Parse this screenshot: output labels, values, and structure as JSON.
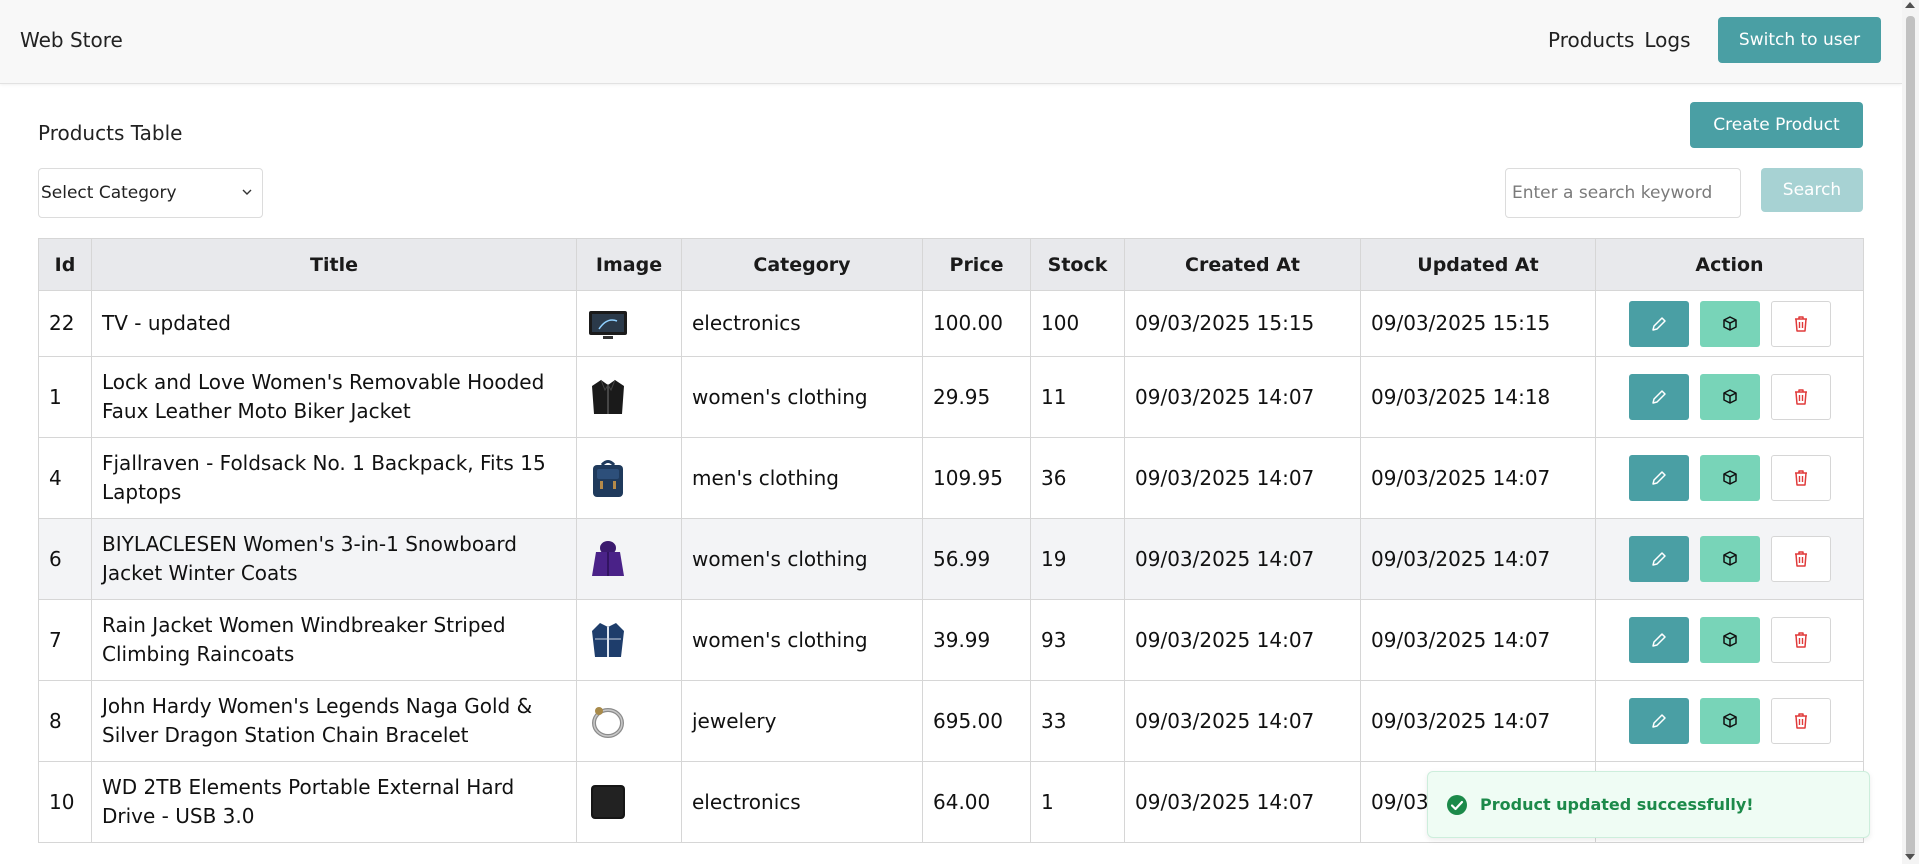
{
  "navbar": {
    "brand": "Web Store",
    "links": [
      "Products",
      "Logs"
    ],
    "switch_label": "Switch to user"
  },
  "page": {
    "title": "Products Table",
    "create_label": "Create Product"
  },
  "filters": {
    "category_selected": "Select Category",
    "search_placeholder": "Enter a search keyword",
    "search_label": "Search"
  },
  "table": {
    "columns": [
      "Id",
      "Title",
      "Image",
      "Category",
      "Price",
      "Stock",
      "Created At",
      "Updated At",
      "Action"
    ],
    "rows": [
      {
        "id": "22",
        "title": "TV - updated",
        "image_icon": "tv-icon",
        "category": "electronics",
        "price": "100.00",
        "stock": "100",
        "created": "09/03/2025 15:15",
        "updated": "09/03/2025 15:15"
      },
      {
        "id": "1",
        "title": "Lock and Love Women's Removable Hooded Faux Leather Moto Biker Jacket",
        "image_icon": "jacket-icon",
        "category": "women's clothing",
        "price": "29.95",
        "stock": "11",
        "created": "09/03/2025 14:07",
        "updated": "09/03/2025 14:18"
      },
      {
        "id": "4",
        "title": "Fjallraven - Foldsack No. 1 Backpack, Fits 15 Laptops",
        "image_icon": "backpack-icon",
        "category": "men's clothing",
        "price": "109.95",
        "stock": "36",
        "created": "09/03/2025 14:07",
        "updated": "09/03/2025 14:07"
      },
      {
        "id": "6",
        "title": "BIYLACLESEN Women's 3-in-1 Snowboard Jacket Winter Coats",
        "image_icon": "coat-icon",
        "category": "women's clothing",
        "price": "56.99",
        "stock": "19",
        "created": "09/03/2025 14:07",
        "updated": "09/03/2025 14:07"
      },
      {
        "id": "7",
        "title": "Rain Jacket Women Windbreaker Striped Climbing Raincoats",
        "image_icon": "raincoat-icon",
        "category": "women's clothing",
        "price": "39.99",
        "stock": "93",
        "created": "09/03/2025 14:07",
        "updated": "09/03/2025 14:07"
      },
      {
        "id": "8",
        "title": "John Hardy Women's Legends Naga Gold & Silver Dragon Station Chain Bracelet",
        "image_icon": "bracelet-icon",
        "category": "jewelery",
        "price": "695.00",
        "stock": "33",
        "created": "09/03/2025 14:07",
        "updated": "09/03/2025 14:07"
      },
      {
        "id": "10",
        "title": "WD 2TB Elements Portable External Hard Drive - USB 3.0",
        "image_icon": "hard-drive-icon",
        "category": "electronics",
        "price": "64.00",
        "stock": "1",
        "created": "09/03/2025 14:07",
        "updated": "09/03"
      }
    ]
  },
  "toast": {
    "message": "Product updated successfully!",
    "icon": "check-circle-icon"
  },
  "colors": {
    "primary": "#4a9fa4",
    "stock_button": "#78d4b8",
    "delete_icon": "#e03a3a",
    "success": "#1c8a4a"
  }
}
